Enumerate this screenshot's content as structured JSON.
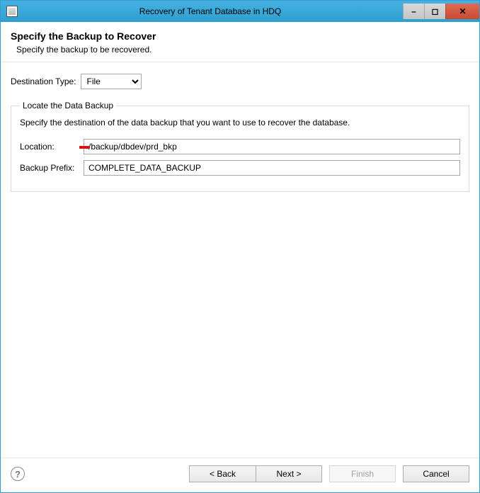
{
  "window": {
    "title": "Recovery of Tenant Database in HDQ"
  },
  "titlebar_controls": {
    "minimize": "–",
    "maximize": "▢",
    "close": "✕"
  },
  "header": {
    "title": "Specify the Backup to Recover",
    "subtitle": "Specify the backup to be recovered."
  },
  "destination": {
    "label": "Destination Type:",
    "selected": "File",
    "options": [
      "File"
    ]
  },
  "group": {
    "legend": "Locate the Data Backup",
    "description": "Specify the destination of the data backup that you want to use to recover the database.",
    "location_label": "Location:",
    "location_value": "/backup/dbdev/prd_bkp",
    "prefix_label": "Backup Prefix:",
    "prefix_value": "COMPLETE_DATA_BACKUP"
  },
  "footer": {
    "help_tooltip": "?",
    "back": "< Back",
    "next": "Next >",
    "finish": "Finish",
    "cancel": "Cancel"
  }
}
